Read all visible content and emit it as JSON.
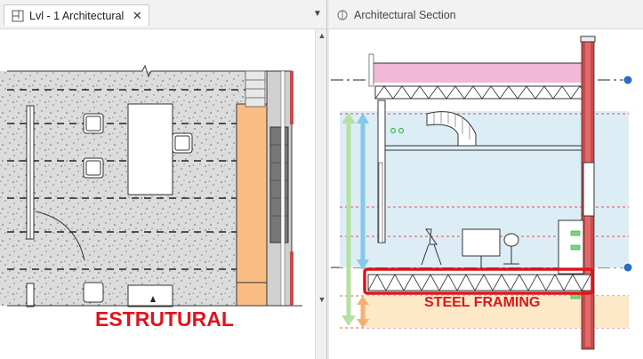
{
  "left_view": {
    "tab_title": "Lvl - 1 Architectural",
    "tab_icon": "floor-plan-icon",
    "close_icon": "close-icon",
    "menu_icon": "dropdown-arrow-icon",
    "annotation": "ESTRUTURAL"
  },
  "right_view": {
    "tab_title": "Architectural Section",
    "tab_icon": "section-view-icon",
    "annotation": "STEEL FRAMING"
  },
  "colors": {
    "annotation_red": "#e0141c",
    "ceiling_pink": "#f2b8d6",
    "room_blue": "#dcedf6",
    "floor_peach": "#fde9c8",
    "column_orange": "#f9bd84",
    "brick": "#c94a4a"
  }
}
